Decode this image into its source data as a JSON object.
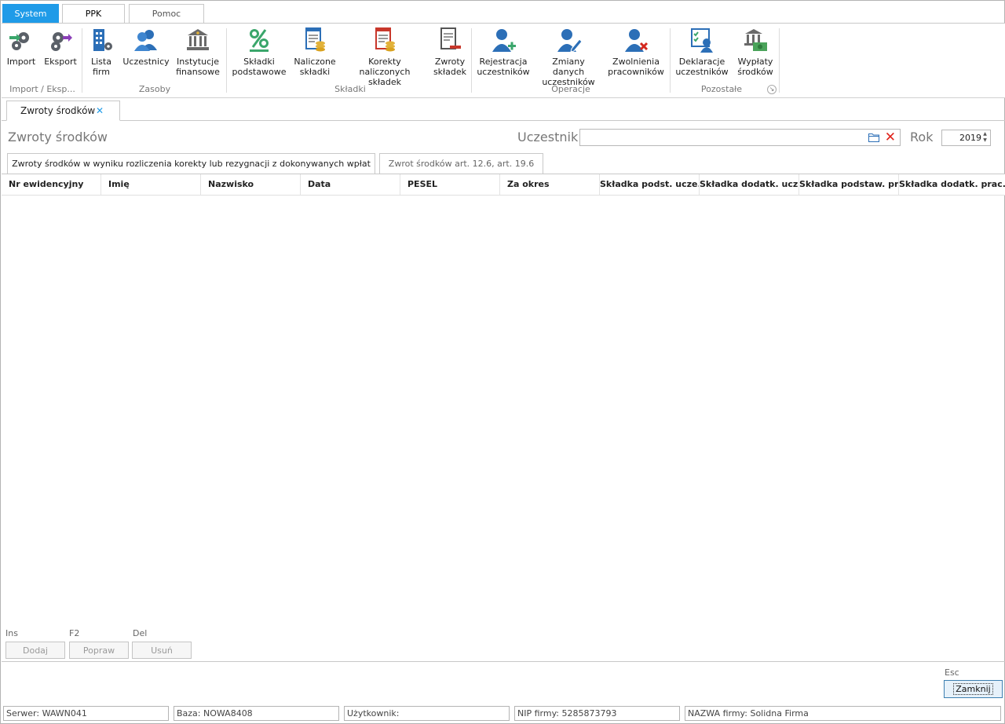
{
  "ribbon_tabs": [
    "System",
    "PPK",
    "Pomoc"
  ],
  "ribbon_buttons": {
    "import": "Import",
    "eksport": "Eksport",
    "lista_firm": "Lista\nfirm",
    "uczestnicy": "Uczestnicy",
    "instytucje": "Instytucje\nfinansowe",
    "skladki_podstawowe": "Składki\npodstawowe",
    "naliczone": "Naliczone\nskładki",
    "korekty": "Korekty naliczonych\nskładek",
    "zwroty_skladek": "Zwroty\nskładek",
    "rejestracja": "Rejestracja\nuczestników",
    "zmiany": "Zmiany danych\nuczestników",
    "zwolnienia": "Zwolnienia\npracowników",
    "deklaracje": "Deklaracje\nuczestników",
    "wyplaty": "Wypłaty\nśrodków"
  },
  "ribbon_groups": {
    "import_eksport": "Import / Eksp...",
    "zasoby": "Zasoby",
    "skladki": "Składki",
    "operacje": "Operacje",
    "pozostale": "Pozostałe"
  },
  "doc_tab": {
    "label": "Zwroty środków",
    "close": "✕"
  },
  "header": {
    "title": "Zwroty środków",
    "uczestnik_label": "Uczestnik",
    "uczestnik_value": "",
    "rok_label": "Rok",
    "rok_value": "2019"
  },
  "sub_tabs": {
    "active": "Zwroty środków w wyniku rozliczenia korekty lub rezygnacji z dokonywanych wpłat",
    "inactive": "Zwrot środków art. 12.6, art. 19.6"
  },
  "grid": {
    "columns": [
      "Nr ewidencyjny",
      "Imię",
      "Nazwisko",
      "Data",
      "PESEL",
      "Za okres",
      "Składka podst. ucze...",
      "Składka dodatk. ucz...",
      "Składka podstaw. pr...",
      "Składka dodatk. prac..."
    ],
    "rows": []
  },
  "actions": {
    "ins_hint": "Ins",
    "dodaj": "Dodaj",
    "f2_hint": "F2",
    "popraw": "Popraw",
    "del_hint": "Del",
    "usun": "Usuń",
    "esc_hint": "Esc",
    "zamknij": "Zamknij"
  },
  "status_bar": {
    "serwer": "Serwer: WAWN041",
    "baza": "Baza: NOWA8408",
    "uzytkownik": "Użytkownik:",
    "nip": "NIP firmy: 5285873793",
    "nazwa": "NAZWA firmy: Solidna Firma"
  },
  "colors": {
    "accent": "#1f9be8",
    "clear_red": "#e0231b",
    "icon_blue": "#2c6fb7",
    "icon_green": "#3aa66b"
  }
}
